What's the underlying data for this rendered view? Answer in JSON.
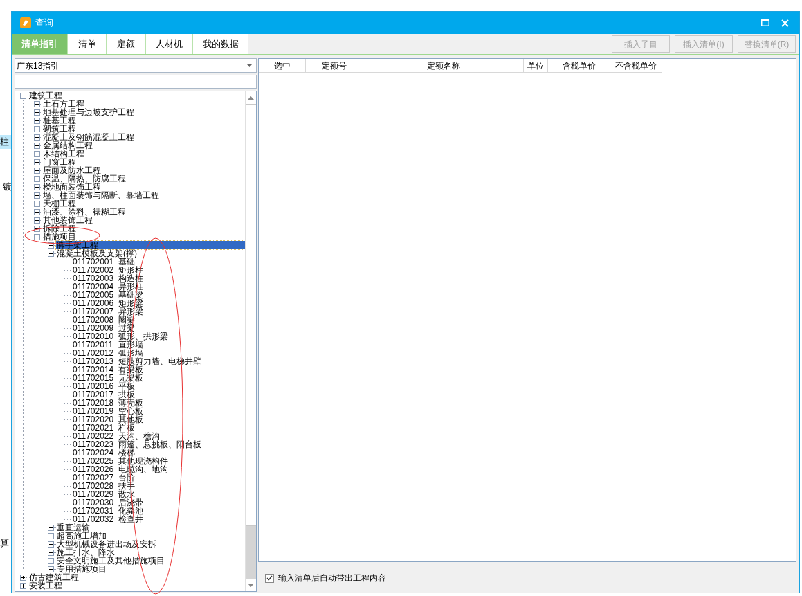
{
  "background": {
    "texts": [
      "柱",
      "镀",
      "算"
    ]
  },
  "window": {
    "title": "查询"
  },
  "tabs": [
    {
      "label": "清单指引",
      "selected": true
    },
    {
      "label": "清单",
      "selected": false
    },
    {
      "label": "定额",
      "selected": false
    },
    {
      "label": "人材机",
      "selected": false
    },
    {
      "label": "我的数据",
      "selected": false
    }
  ],
  "toolbar_buttons": [
    {
      "label": "插入子目",
      "disabled": true
    },
    {
      "label": "插入清单(I)",
      "disabled": true
    },
    {
      "label": "替换清单(R)",
      "disabled": true
    }
  ],
  "guide_select": {
    "value": "广东13指引"
  },
  "tree": [
    {
      "kind": "group",
      "label": "建筑工程",
      "expanded": true,
      "selected": false,
      "children": [
        {
          "kind": "group",
          "label": "土石方工程",
          "expanded": false,
          "selected": false
        },
        {
          "kind": "group",
          "label": "地基处理与边坡支护工程",
          "expanded": false,
          "selected": false
        },
        {
          "kind": "group",
          "label": "桩基工程",
          "expanded": false,
          "selected": false
        },
        {
          "kind": "group",
          "label": "砌筑工程",
          "expanded": false,
          "selected": false
        },
        {
          "kind": "group",
          "label": "混凝土及钢筋混凝土工程",
          "expanded": false,
          "selected": false
        },
        {
          "kind": "group",
          "label": "金属结构工程",
          "expanded": false,
          "selected": false
        },
        {
          "kind": "group",
          "label": "木结构工程",
          "expanded": false,
          "selected": false
        },
        {
          "kind": "group",
          "label": "门窗工程",
          "expanded": false,
          "selected": false
        },
        {
          "kind": "group",
          "label": "屋面及防水工程",
          "expanded": false,
          "selected": false
        },
        {
          "kind": "group",
          "label": "保温、隔热、防腐工程",
          "expanded": false,
          "selected": false
        },
        {
          "kind": "group",
          "label": "楼地面装饰工程",
          "expanded": false,
          "selected": false
        },
        {
          "kind": "group",
          "label": "墙、柱面装饰与隔断、幕墙工程",
          "expanded": false,
          "selected": false
        },
        {
          "kind": "group",
          "label": "天棚工程",
          "expanded": false,
          "selected": false
        },
        {
          "kind": "group",
          "label": "油漆、涂料、裱糊工程",
          "expanded": false,
          "selected": false
        },
        {
          "kind": "group",
          "label": "其他装饰工程",
          "expanded": false,
          "selected": false
        },
        {
          "kind": "group",
          "label": "拆除工程",
          "expanded": false,
          "selected": false
        },
        {
          "kind": "group",
          "label": "措施项目",
          "expanded": true,
          "selected": false,
          "children": [
            {
              "kind": "group",
              "label": "脚手架工程",
              "expanded": false,
              "selected": true
            },
            {
              "kind": "group",
              "label": "混凝土模板及支架(撑)",
              "expanded": true,
              "selected": false,
              "children": [
                {
                  "kind": "item",
                  "code": "011702001",
                  "name": "基础",
                  "selected": false
                },
                {
                  "kind": "item",
                  "code": "011702002",
                  "name": "矩形柱",
                  "selected": false
                },
                {
                  "kind": "item",
                  "code": "011702003",
                  "name": "构造柱",
                  "selected": false
                },
                {
                  "kind": "item",
                  "code": "011702004",
                  "name": "异形柱",
                  "selected": false
                },
                {
                  "kind": "item",
                  "code": "011702005",
                  "name": "基础梁",
                  "selected": false
                },
                {
                  "kind": "item",
                  "code": "011702006",
                  "name": "矩形梁",
                  "selected": false
                },
                {
                  "kind": "item",
                  "code": "011702007",
                  "name": "异形梁",
                  "selected": false
                },
                {
                  "kind": "item",
                  "code": "011702008",
                  "name": "圈梁",
                  "selected": false
                },
                {
                  "kind": "item",
                  "code": "011702009",
                  "name": "过梁",
                  "selected": false
                },
                {
                  "kind": "item",
                  "code": "011702010",
                  "name": "弧形、拱形梁",
                  "selected": false
                },
                {
                  "kind": "item",
                  "code": "011702011",
                  "name": "直形墙",
                  "selected": false
                },
                {
                  "kind": "item",
                  "code": "011702012",
                  "name": "弧形墙",
                  "selected": false
                },
                {
                  "kind": "item",
                  "code": "011702013",
                  "name": "短肢剪力墙、电梯井壁",
                  "selected": false
                },
                {
                  "kind": "item",
                  "code": "011702014",
                  "name": "有梁板",
                  "selected": false
                },
                {
                  "kind": "item",
                  "code": "011702015",
                  "name": "无梁板",
                  "selected": false
                },
                {
                  "kind": "item",
                  "code": "011702016",
                  "name": "平板",
                  "selected": false
                },
                {
                  "kind": "item",
                  "code": "011702017",
                  "name": "拱板",
                  "selected": false
                },
                {
                  "kind": "item",
                  "code": "011702018",
                  "name": "薄壳板",
                  "selected": false
                },
                {
                  "kind": "item",
                  "code": "011702019",
                  "name": "空心板",
                  "selected": false
                },
                {
                  "kind": "item",
                  "code": "011702020",
                  "name": "其他板",
                  "selected": false
                },
                {
                  "kind": "item",
                  "code": "011702021",
                  "name": "栏板",
                  "selected": false
                },
                {
                  "kind": "item",
                  "code": "011702022",
                  "name": "天沟、檐沟",
                  "selected": false
                },
                {
                  "kind": "item",
                  "code": "011702023",
                  "name": "雨篷、悬挑板、阳台板",
                  "selected": false
                },
                {
                  "kind": "item",
                  "code": "011702024",
                  "name": "楼梯",
                  "selected": false
                },
                {
                  "kind": "item",
                  "code": "011702025",
                  "name": "其他现浇构件",
                  "selected": false
                },
                {
                  "kind": "item",
                  "code": "011702026",
                  "name": "电缆沟、地沟",
                  "selected": false
                },
                {
                  "kind": "item",
                  "code": "011702027",
                  "name": "台阶",
                  "selected": false
                },
                {
                  "kind": "item",
                  "code": "011702028",
                  "name": "扶手",
                  "selected": false
                },
                {
                  "kind": "item",
                  "code": "011702029",
                  "name": "散水",
                  "selected": false
                },
                {
                  "kind": "item",
                  "code": "011702030",
                  "name": "后浇带",
                  "selected": false
                },
                {
                  "kind": "item",
                  "code": "011702031",
                  "name": "化粪池",
                  "selected": false
                },
                {
                  "kind": "item",
                  "code": "011702032",
                  "name": "检查井",
                  "selected": false
                }
              ]
            },
            {
              "kind": "group",
              "label": "垂直运输",
              "expanded": false,
              "selected": false
            },
            {
              "kind": "group",
              "label": "超高施工增加",
              "expanded": false,
              "selected": false
            },
            {
              "kind": "group",
              "label": "大型机械设备进出场及安拆",
              "expanded": false,
              "selected": false
            },
            {
              "kind": "group",
              "label": "施工排水、降水",
              "expanded": false,
              "selected": false
            },
            {
              "kind": "group",
              "label": "安全文明施工及其他措施项目",
              "expanded": false,
              "selected": false
            },
            {
              "kind": "group",
              "label": "专用措施项目",
              "expanded": false,
              "selected": false
            }
          ]
        }
      ]
    },
    {
      "kind": "group",
      "label": "仿古建筑工程",
      "expanded": false,
      "selected": false
    },
    {
      "kind": "group",
      "label": "安装工程",
      "expanded": false,
      "selected": false
    }
  ],
  "table": {
    "columns": [
      "选中",
      "定额号",
      "定额名称",
      "单位",
      "含税单价",
      "不含税单价"
    ]
  },
  "auto_fill_option": {
    "label": "输入清单后自动带出工程内容",
    "checked": true
  }
}
